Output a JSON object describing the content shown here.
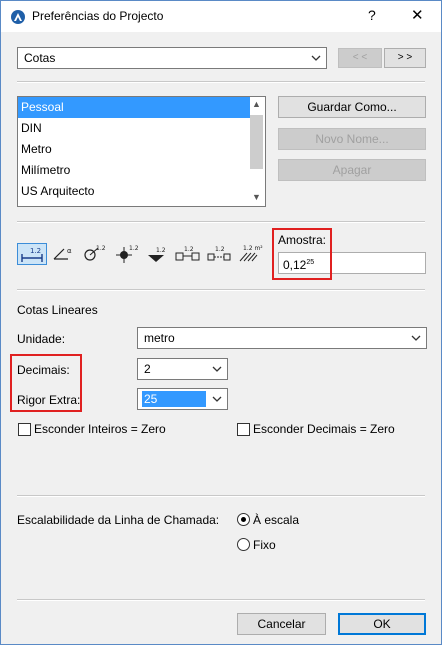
{
  "window": {
    "title": "Preferências do Projecto",
    "help": "?",
    "close": "✕"
  },
  "top": {
    "category_value": "Cotas",
    "prev_label": "< <",
    "next_label": "> >"
  },
  "presets": {
    "items": [
      "Pessoal",
      "DIN",
      "Metro",
      "Milímetro",
      "US Arquitecto"
    ],
    "selected_index": 0
  },
  "buttons": {
    "save_as": "Guardar Como...",
    "new_name": "Novo Nome...",
    "delete": "Apagar"
  },
  "tools": {
    "icons": [
      "linear-dimension-icon",
      "angular-dimension-icon",
      "radial-dimension-icon",
      "level-dimension-icon",
      "elevation-dimension-icon",
      "door-window-dimension-icon",
      "sill-height-dimension-icon",
      "area-dimension-icon"
    ],
    "active_index": 0
  },
  "sample": {
    "label": "Amostra:",
    "value": "0,12",
    "sup": "25"
  },
  "linear": {
    "section_title": "Cotas Lineares",
    "unit_label": "Unidade:",
    "unit_value": "metro",
    "decimals_label": "Decimais:",
    "decimals_value": "2",
    "extra_label": "Rigor Extra:",
    "extra_value": "25",
    "hide_integer_label": "Esconder Inteiros = Zero",
    "hide_decimal_label": "Esconder Decimais = Zero"
  },
  "leader": {
    "label": "Escalabilidade da Linha de Chamada:",
    "option1": "À escala",
    "option2": "Fixo",
    "selected": "option1"
  },
  "footer": {
    "cancel": "Cancelar",
    "ok": "OK"
  },
  "colors": {
    "accent": "#3399ff",
    "highlight": "#e02020"
  }
}
